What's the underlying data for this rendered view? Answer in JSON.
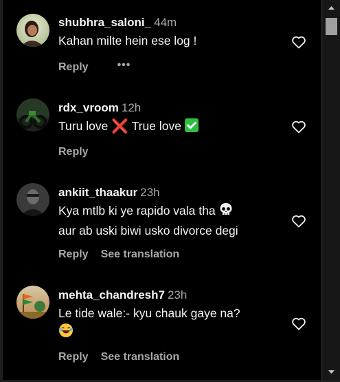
{
  "comments": [
    {
      "username": "shubhra_saloni_",
      "time": "44m",
      "text": "Kahan milte hein ese log !",
      "reply_label": "Reply",
      "more_label": "•••"
    },
    {
      "username": "rdx_vroom",
      "time": "12h",
      "text_part1": "Turu love ",
      "text_part2": " True love ",
      "emoji_cross": "❌",
      "reply_label": "Reply"
    },
    {
      "username": "ankiit_thaakur",
      "time": "23h",
      "text_line1": "Kya mtlb ki ye rapido vala tha",
      "text_line2": "aur ab uski biwi usko divorce degi",
      "reply_label": "Reply",
      "translate_label": "See translation"
    },
    {
      "username": "mehta_chandresh7",
      "time": "23h",
      "text_line1": "Le tide wale:- kyu chauk gaye na?",
      "reply_label": "Reply",
      "translate_label": "See translation"
    }
  ],
  "colors": {
    "background": "#000000",
    "primary_text": "#f5f5f5",
    "secondary_text": "#a8a8a8",
    "scrollbar_track": "#171717",
    "scrollbar_thumb": "#a0a0a0"
  },
  "icons": [
    "heart-icon",
    "more-icon",
    "scroll-up-arrow-icon",
    "scroll-down-arrow-icon"
  ]
}
